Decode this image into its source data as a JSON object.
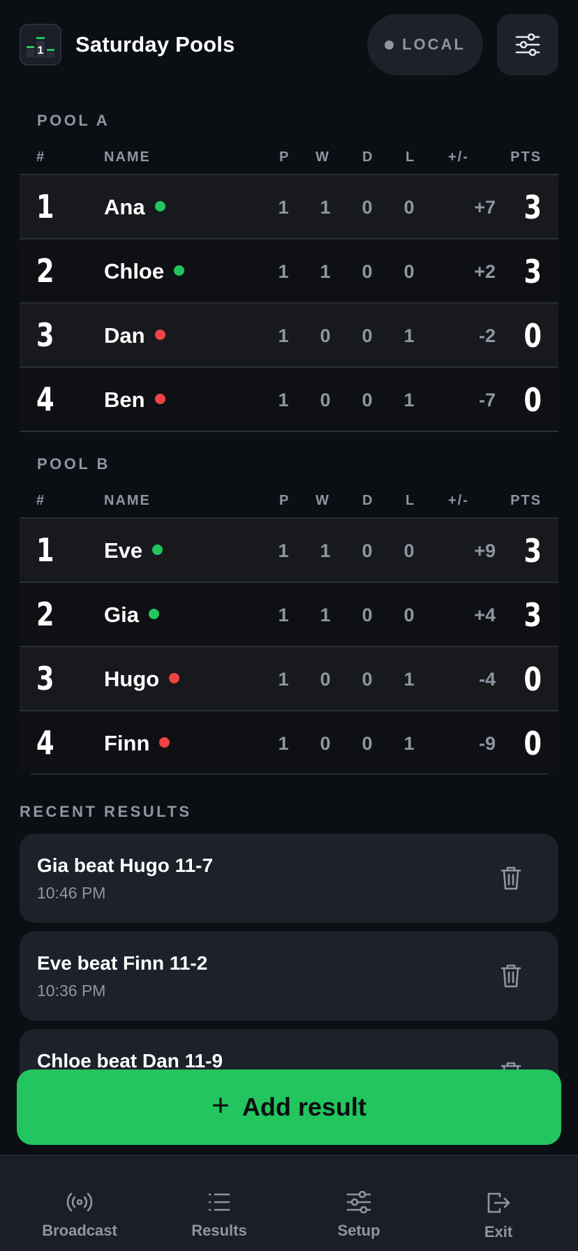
{
  "app": {
    "title": "Saturday Pools",
    "logo_glyph": "1"
  },
  "header": {
    "mode_label": "LOCAL",
    "settings_icon": "sliders-icon"
  },
  "columns": {
    "rank": "#",
    "name": "NAME",
    "p": "P",
    "w": "W",
    "d": "D",
    "l": "L",
    "diff": "+/-",
    "pts": "PTS"
  },
  "colors": {
    "win": "#22c55e",
    "loss": "#ef4444",
    "accent": "#22c55e"
  },
  "pools": [
    {
      "title": "POOL A",
      "rows": [
        {
          "rank": "1",
          "name": "Ana",
          "status": "win",
          "p": "1",
          "w": "1",
          "d": "0",
          "l": "0",
          "diff": "+7",
          "pts": "3"
        },
        {
          "rank": "2",
          "name": "Chloe",
          "status": "win",
          "p": "1",
          "w": "1",
          "d": "0",
          "l": "0",
          "diff": "+2",
          "pts": "3"
        },
        {
          "rank": "3",
          "name": "Dan",
          "status": "loss",
          "p": "1",
          "w": "0",
          "d": "0",
          "l": "1",
          "diff": "-2",
          "pts": "0"
        },
        {
          "rank": "4",
          "name": "Ben",
          "status": "loss",
          "p": "1",
          "w": "0",
          "d": "0",
          "l": "1",
          "diff": "-7",
          "pts": "0"
        }
      ]
    },
    {
      "title": "POOL B",
      "rows": [
        {
          "rank": "1",
          "name": "Eve",
          "status": "win",
          "p": "1",
          "w": "1",
          "d": "0",
          "l": "0",
          "diff": "+9",
          "pts": "3"
        },
        {
          "rank": "2",
          "name": "Gia",
          "status": "win",
          "p": "1",
          "w": "1",
          "d": "0",
          "l": "0",
          "diff": "+4",
          "pts": "3"
        },
        {
          "rank": "3",
          "name": "Hugo",
          "status": "loss",
          "p": "1",
          "w": "0",
          "d": "0",
          "l": "1",
          "diff": "-4",
          "pts": "0"
        },
        {
          "rank": "4",
          "name": "Finn",
          "status": "loss",
          "p": "1",
          "w": "0",
          "d": "0",
          "l": "1",
          "diff": "-9",
          "pts": "0"
        }
      ]
    }
  ],
  "recent": {
    "title": "RECENT RESULTS",
    "items": [
      {
        "text": "Gia beat Hugo 11-7",
        "time": "10:46 PM"
      },
      {
        "text": "Eve beat Finn 11-2",
        "time": "10:36 PM"
      },
      {
        "text": "Chloe beat Dan 11-9",
        "time": ""
      }
    ]
  },
  "actions": {
    "add_result": "Add result"
  },
  "nav": [
    {
      "label": "Broadcast",
      "icon": "broadcast-icon"
    },
    {
      "label": "Results",
      "icon": "list-icon"
    },
    {
      "label": "Setup",
      "icon": "sliders-icon"
    },
    {
      "label": "Exit",
      "icon": "exit-icon"
    }
  ]
}
